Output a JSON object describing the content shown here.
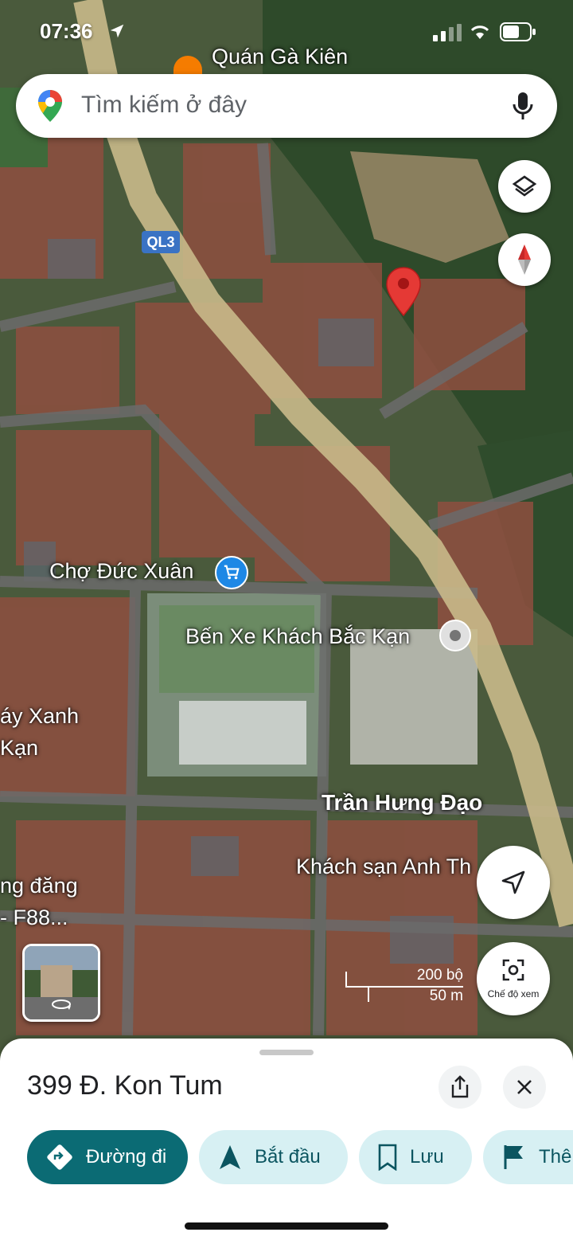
{
  "status_bar": {
    "time": "07:36"
  },
  "search": {
    "placeholder": "Tìm kiếm ở đây"
  },
  "map_labels": {
    "poi_top": "Quán Gà Kiên",
    "route_shield": "QL3",
    "market": "Chợ Đức Xuân",
    "bus_station": "Bến Xe Khách Bắc Kạn",
    "left_label_1": "áy Xanh",
    "left_label_2": "Kạn",
    "street": "Trần Hưng Đạo",
    "hotel": "Khách sạn Anh Th",
    "left_label_3": "ng đăng",
    "left_label_4": "- F88..."
  },
  "scale": {
    "imperial": "200 bộ",
    "metric": "50 m"
  },
  "view_mode_label": "Chế độ xem",
  "place": {
    "address": "399 Đ. Kon Tum"
  },
  "actions": {
    "directions": "Đường đi",
    "start": "Bắt đầu",
    "save": "Lưu",
    "more": "Thê"
  },
  "colors": {
    "primary_chip": "#0b6b74",
    "secondary_chip": "#d7f0f3",
    "pin": "#e53935",
    "road": "#c9b98a"
  }
}
